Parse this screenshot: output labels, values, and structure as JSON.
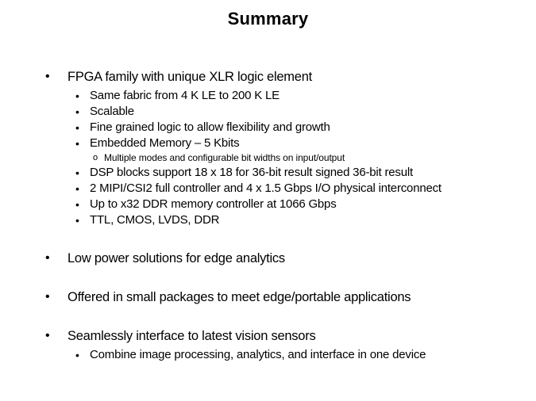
{
  "slide": {
    "title": "Summary",
    "background_color": "#ffffff",
    "text_color": "#000000",
    "bullet_marker_level1": "•",
    "bullet_marker_level2": "•",
    "bullet_marker_level3": "o",
    "content": [
      {
        "level": 1,
        "text": "FPGA family with unique XLR logic element"
      },
      {
        "level": 2,
        "text": "Same fabric from 4 K LE to 200 K LE"
      },
      {
        "level": 2,
        "text": "Scalable"
      },
      {
        "level": 2,
        "text": "Fine grained logic to allow flexibility and growth"
      },
      {
        "level": 2,
        "text": "Embedded Memory – 5 Kbits"
      },
      {
        "level": 3,
        "text": "Multiple modes and configurable bit widths on input/output"
      },
      {
        "level": 2,
        "text": "DSP blocks support 18 x 18 for 36-bit result signed 36-bit result"
      },
      {
        "level": 2,
        "text": "2 MIPI/CSI2  full controller and 4 x 1.5 Gbps I/O physical interconnect"
      },
      {
        "level": 2,
        "text": "Up to x32 DDR memory controller at 1066 Gbps"
      },
      {
        "level": 2,
        "text": "TTL, CMOS, LVDS, DDR"
      },
      {
        "level": 1,
        "text": "Low power solutions for edge analytics"
      },
      {
        "level": 1,
        "text": "Offered in small packages to meet edge/portable applications"
      },
      {
        "level": 1,
        "text": "Seamlessly interface to latest vision sensors"
      },
      {
        "level": 2,
        "text": "Combine image processing, analytics, and interface in one device"
      }
    ]
  }
}
